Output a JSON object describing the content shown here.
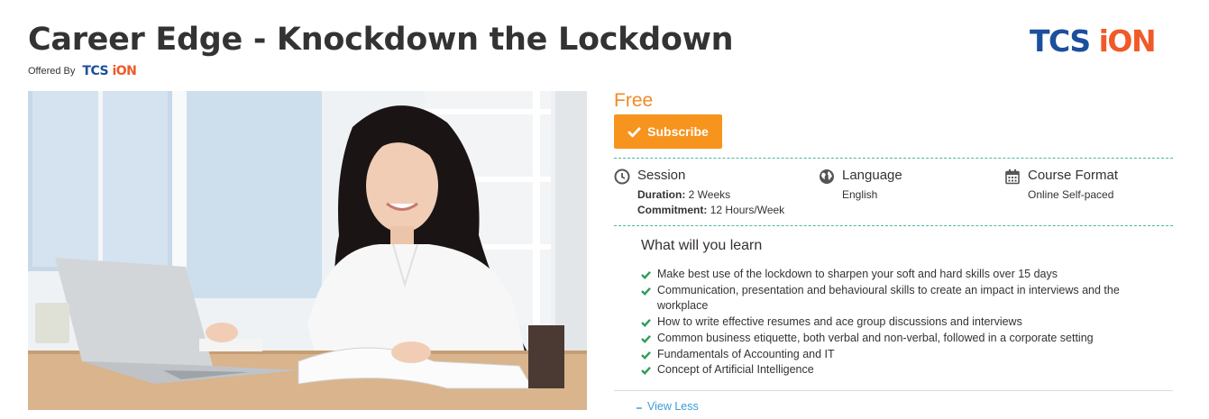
{
  "course": {
    "title": "Career Edge - Knockdown the Lockdown",
    "offered_by": "Offered By",
    "provider_logo": {
      "tcs": "TCS ",
      "ion": "iON"
    }
  },
  "purchase": {
    "price": "Free",
    "subscribe_label": "Subscribe"
  },
  "details": {
    "session": {
      "heading": "Session",
      "duration_label": "Duration:",
      "duration_value": "2 Weeks",
      "commitment_label": "Commitment:",
      "commitment_value": "12 Hours/Week"
    },
    "language": {
      "heading": "Language",
      "value": "English"
    },
    "format": {
      "heading": "Course Format",
      "value": "Online Self-paced"
    }
  },
  "learn": {
    "heading": "What will you learn",
    "items": [
      "Make best use of the lockdown to sharpen your soft and hard skills over 15 days",
      "Communication, presentation and behavioural skills to create an impact in interviews and the workplace",
      "How to write effective resumes and ace group discussions and interviews",
      "Common business etiquette, both verbal and non-verbal, followed in a corporate setting",
      "Fundamentals of Accounting and IT",
      "Concept of Artificial Intelligence"
    ],
    "toggle_label": "View Less"
  },
  "colors": {
    "accent_orange": "#f7941d",
    "price_orange": "#f08a24",
    "check_green": "#2e9e5b",
    "link_blue": "#3a9bd5",
    "tcs_blue": "#1c4f9c",
    "ion_orange": "#f05a28"
  },
  "icons": {
    "session": "clock-icon",
    "language": "globe-icon",
    "format": "calendar-icon",
    "subscribe": "checkmark-icon",
    "list_bullet": "check-icon",
    "toggle": "chevron-up-icon"
  }
}
